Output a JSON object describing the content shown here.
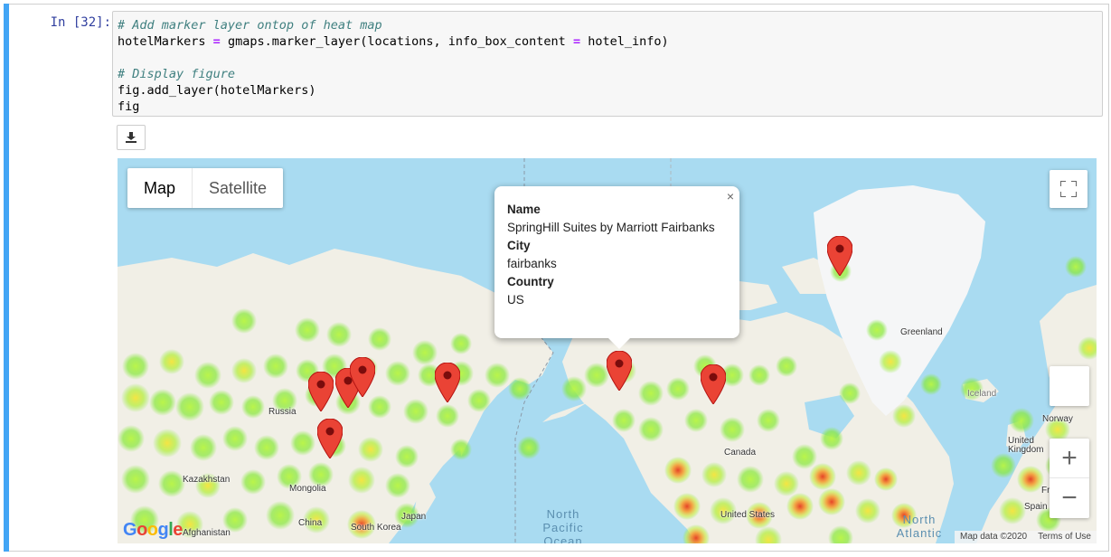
{
  "cell": {
    "prompt": "In [32]:",
    "code": [
      {
        "type": "comment",
        "text": "# Add marker layer ontop of heat map"
      },
      {
        "type": "code",
        "before": "hotelMarkers ",
        "op1": "=",
        "mid": " gmaps.marker_layer(locations, info_box_content ",
        "op2": "=",
        "after": " hotel_info)"
      },
      {
        "type": "blank",
        "text": ""
      },
      {
        "type": "comment",
        "text": "# Display figure"
      },
      {
        "type": "plain",
        "text": "fig.add_layer(hotelMarkers)"
      },
      {
        "type": "plain",
        "text": "fig"
      }
    ]
  },
  "download_button": {
    "icon": "download-icon"
  },
  "map": {
    "type_control": {
      "map_label": "Map",
      "satellite_label": "Satellite"
    },
    "fullscreen_icon": "fullscreen-icon",
    "zoom_in_label": "+",
    "zoom_out_label": "−",
    "labels": {
      "russia": "Russia",
      "kazakhstan": "Kazakhstan",
      "mongolia": "Mongolia",
      "china": "China",
      "south_korea": "South Korea",
      "japan": "Japan",
      "afghanistan": "Afghanistan",
      "canada": "Canada",
      "united_states": "United States",
      "greenland": "Greenland",
      "iceland": "Iceland",
      "norway": "Norway",
      "united_kingdom": "United Kingdom",
      "france": "Franc",
      "spain": "Spain"
    },
    "oceans": {
      "north_pacific": "North Pacific Ocean",
      "north_atlantic": "North Atlantic"
    },
    "popup": {
      "name_key": "Name",
      "name_value": "SpringHill Suites by Marriott Fairbanks",
      "city_key": "City",
      "city_value": "fairbanks",
      "country_key": "Country",
      "country_value": "US",
      "close": "×"
    },
    "attribution": "Map data ©2020",
    "terms": "Terms of Use",
    "logo": "Google",
    "colors": {
      "water": "#a9dbf1",
      "land": "#f1efe6",
      "greenland": "#f5f6f7",
      "marker": "#ea4335",
      "heat_low": "#9cf03a",
      "heat_high": "#e53b1d"
    }
  }
}
